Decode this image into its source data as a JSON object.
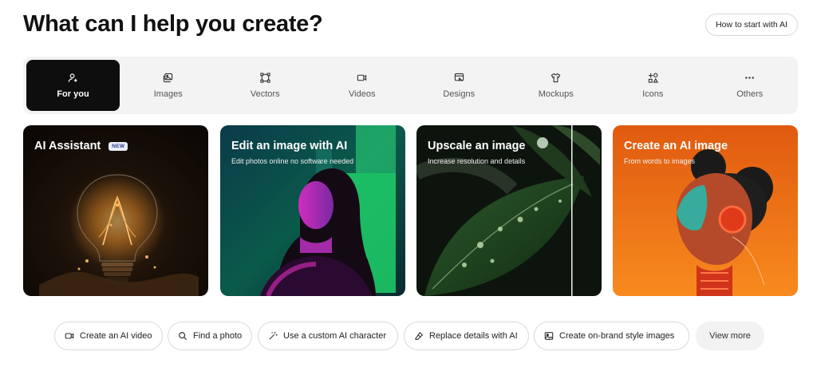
{
  "header": {
    "title": "What can I help you create?",
    "howto_label": "How to start with AI"
  },
  "tabs": [
    {
      "label": "For you",
      "icon": "person-sparkle-icon",
      "active": true
    },
    {
      "label": "Images",
      "icon": "images-icon",
      "active": false
    },
    {
      "label": "Vectors",
      "icon": "vector-nodes-icon",
      "active": false
    },
    {
      "label": "Videos",
      "icon": "video-camera-icon",
      "active": false
    },
    {
      "label": "Designs",
      "icon": "design-editor-icon",
      "active": false
    },
    {
      "label": "Mockups",
      "icon": "tshirt-icon",
      "active": false
    },
    {
      "label": "Icons",
      "icon": "icon-shapes-icon",
      "active": false
    },
    {
      "label": "Others",
      "icon": "more-dots-icon",
      "active": false
    }
  ],
  "cards": [
    {
      "title": "AI Assistant",
      "subtitle": "",
      "badge": "NEW",
      "accent": "#1a1008"
    },
    {
      "title": "Edit an image with AI",
      "subtitle": "Edit photos online no software needed",
      "accent": "#0c5a4a"
    },
    {
      "title": "Upscale an image",
      "subtitle": "Increase resolution and details",
      "accent": "#1a2a1a"
    },
    {
      "title": "Create an AI image",
      "subtitle": "From words to images",
      "accent": "#f27a1a"
    }
  ],
  "chips": [
    {
      "label": "Create an AI video",
      "icon": "video-camera-icon"
    },
    {
      "label": "Find a photo",
      "icon": "search-icon"
    },
    {
      "label": "Use a custom AI character",
      "icon": "magic-wand-icon"
    },
    {
      "label": "Replace details with AI",
      "icon": "eraser-icon"
    },
    {
      "label": "Create on-brand style images",
      "icon": "image-style-icon"
    },
    {
      "label": "View more",
      "icon": ""
    }
  ]
}
